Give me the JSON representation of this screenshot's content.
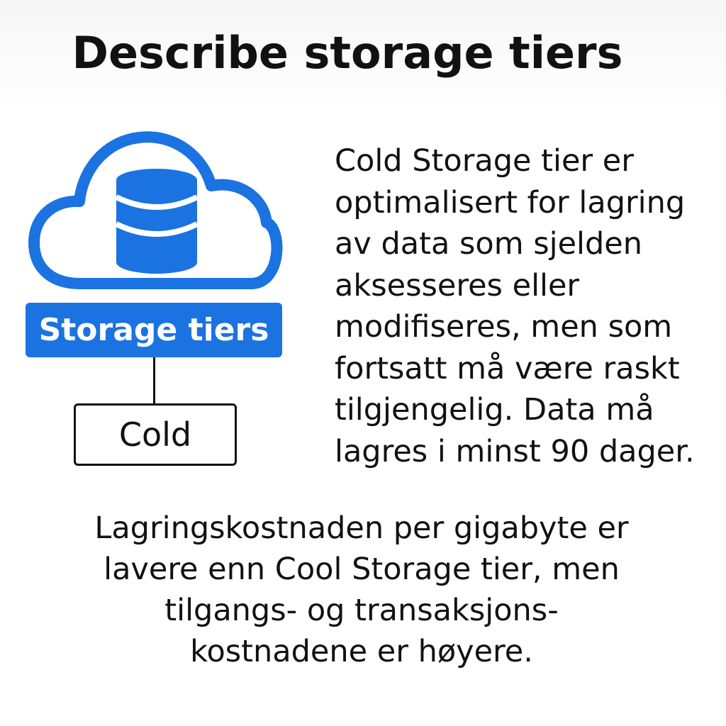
{
  "title": "Describe storage tiers",
  "diagram": {
    "icon": "cloud-database-icon",
    "label": "Storage tiers",
    "child": "Cold"
  },
  "description_lines": [
    "Cold Storage tier er",
    "optimalisert for lagring",
    "av data som sjelden",
    "aksesseres eller",
    "modifiseres, men som",
    "fortsatt må være raskt",
    "tilgjengelig. Data må",
    "lagres i minst 90 dager."
  ],
  "footnote_lines": [
    "Lagringskostnaden per gigabyte er",
    "lavere enn Cool Storage tier, men",
    "tilgangs- og transaksjons-",
    "kostnadene er høyere."
  ],
  "colors": {
    "accent": "#1a73e0",
    "text": "#111111",
    "background": "#ffffff"
  }
}
